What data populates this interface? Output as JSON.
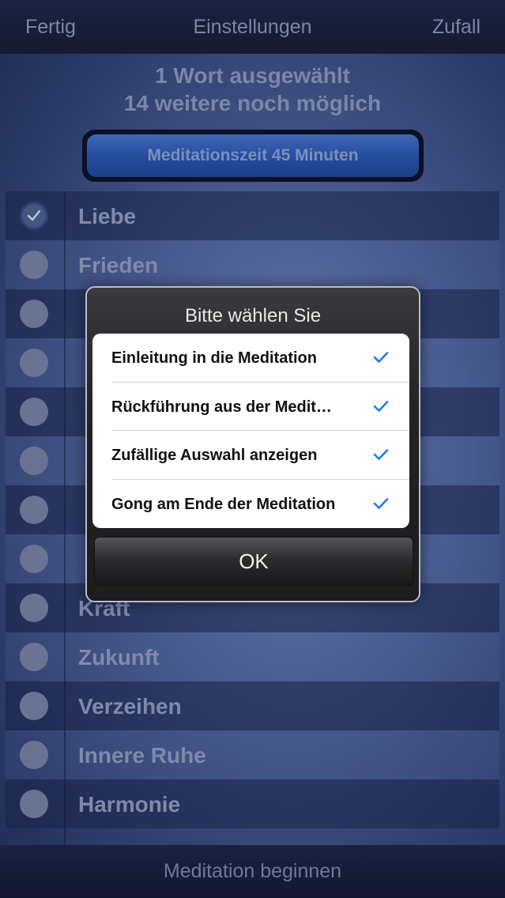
{
  "navbar": {
    "left": "Fertig",
    "title": "Einstellungen",
    "right": "Zufall"
  },
  "info": {
    "line1": "1 Wort ausgewählt",
    "line2": "14 weitere noch möglich"
  },
  "time_button": "Meditationszeit 45 Minuten",
  "words": [
    {
      "label": "Liebe",
      "checked": true
    },
    {
      "label": "Frieden",
      "checked": false
    },
    {
      "label": "",
      "checked": false
    },
    {
      "label": "",
      "checked": false
    },
    {
      "label": "",
      "checked": false
    },
    {
      "label": "",
      "checked": false
    },
    {
      "label": "",
      "checked": false
    },
    {
      "label": "",
      "checked": false
    },
    {
      "label": "Kraft",
      "checked": false
    },
    {
      "label": "Zukunft",
      "checked": false
    },
    {
      "label": "Verzeihen",
      "checked": false
    },
    {
      "label": "Innere Ruhe",
      "checked": false
    },
    {
      "label": "Harmonie",
      "checked": false
    }
  ],
  "footer": "Meditation beginnen",
  "dialog": {
    "title": "Bitte wählen Sie",
    "options": [
      {
        "label": "Einleitung in die Meditation",
        "checked": true
      },
      {
        "label": "Rückführung aus der Medit…",
        "checked": true
      },
      {
        "label": "Zufällige Auswahl anzeigen",
        "checked": true
      },
      {
        "label": "Gong am Ende der Meditation",
        "checked": true
      }
    ],
    "ok": "OK"
  },
  "colors": {
    "check_blue": "#1a7bf2"
  }
}
